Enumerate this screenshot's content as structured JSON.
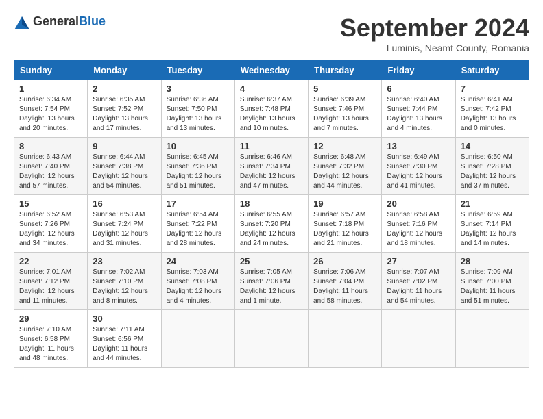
{
  "header": {
    "logo_general": "General",
    "logo_blue": "Blue",
    "month": "September 2024",
    "location": "Luminis, Neamt County, Romania"
  },
  "weekdays": [
    "Sunday",
    "Monday",
    "Tuesday",
    "Wednesday",
    "Thursday",
    "Friday",
    "Saturday"
  ],
  "weeks": [
    [
      {
        "day": "1",
        "sunrise": "6:34 AM",
        "sunset": "7:54 PM",
        "daylight": "13 hours and 20 minutes."
      },
      {
        "day": "2",
        "sunrise": "6:35 AM",
        "sunset": "7:52 PM",
        "daylight": "13 hours and 17 minutes."
      },
      {
        "day": "3",
        "sunrise": "6:36 AM",
        "sunset": "7:50 PM",
        "daylight": "13 hours and 13 minutes."
      },
      {
        "day": "4",
        "sunrise": "6:37 AM",
        "sunset": "7:48 PM",
        "daylight": "13 hours and 10 minutes."
      },
      {
        "day": "5",
        "sunrise": "6:39 AM",
        "sunset": "7:46 PM",
        "daylight": "13 hours and 7 minutes."
      },
      {
        "day": "6",
        "sunrise": "6:40 AM",
        "sunset": "7:44 PM",
        "daylight": "13 hours and 4 minutes."
      },
      {
        "day": "7",
        "sunrise": "6:41 AM",
        "sunset": "7:42 PM",
        "daylight": "13 hours and 0 minutes."
      }
    ],
    [
      {
        "day": "8",
        "sunrise": "6:43 AM",
        "sunset": "7:40 PM",
        "daylight": "12 hours and 57 minutes."
      },
      {
        "day": "9",
        "sunrise": "6:44 AM",
        "sunset": "7:38 PM",
        "daylight": "12 hours and 54 minutes."
      },
      {
        "day": "10",
        "sunrise": "6:45 AM",
        "sunset": "7:36 PM",
        "daylight": "12 hours and 51 minutes."
      },
      {
        "day": "11",
        "sunrise": "6:46 AM",
        "sunset": "7:34 PM",
        "daylight": "12 hours and 47 minutes."
      },
      {
        "day": "12",
        "sunrise": "6:48 AM",
        "sunset": "7:32 PM",
        "daylight": "12 hours and 44 minutes."
      },
      {
        "day": "13",
        "sunrise": "6:49 AM",
        "sunset": "7:30 PM",
        "daylight": "12 hours and 41 minutes."
      },
      {
        "day": "14",
        "sunrise": "6:50 AM",
        "sunset": "7:28 PM",
        "daylight": "12 hours and 37 minutes."
      }
    ],
    [
      {
        "day": "15",
        "sunrise": "6:52 AM",
        "sunset": "7:26 PM",
        "daylight": "12 hours and 34 minutes."
      },
      {
        "day": "16",
        "sunrise": "6:53 AM",
        "sunset": "7:24 PM",
        "daylight": "12 hours and 31 minutes."
      },
      {
        "day": "17",
        "sunrise": "6:54 AM",
        "sunset": "7:22 PM",
        "daylight": "12 hours and 28 minutes."
      },
      {
        "day": "18",
        "sunrise": "6:55 AM",
        "sunset": "7:20 PM",
        "daylight": "12 hours and 24 minutes."
      },
      {
        "day": "19",
        "sunrise": "6:57 AM",
        "sunset": "7:18 PM",
        "daylight": "12 hours and 21 minutes."
      },
      {
        "day": "20",
        "sunrise": "6:58 AM",
        "sunset": "7:16 PM",
        "daylight": "12 hours and 18 minutes."
      },
      {
        "day": "21",
        "sunrise": "6:59 AM",
        "sunset": "7:14 PM",
        "daylight": "12 hours and 14 minutes."
      }
    ],
    [
      {
        "day": "22",
        "sunrise": "7:01 AM",
        "sunset": "7:12 PM",
        "daylight": "12 hours and 11 minutes."
      },
      {
        "day": "23",
        "sunrise": "7:02 AM",
        "sunset": "7:10 PM",
        "daylight": "12 hours and 8 minutes."
      },
      {
        "day": "24",
        "sunrise": "7:03 AM",
        "sunset": "7:08 PM",
        "daylight": "12 hours and 4 minutes."
      },
      {
        "day": "25",
        "sunrise": "7:05 AM",
        "sunset": "7:06 PM",
        "daylight": "12 hours and 1 minute."
      },
      {
        "day": "26",
        "sunrise": "7:06 AM",
        "sunset": "7:04 PM",
        "daylight": "11 hours and 58 minutes."
      },
      {
        "day": "27",
        "sunrise": "7:07 AM",
        "sunset": "7:02 PM",
        "daylight": "11 hours and 54 minutes."
      },
      {
        "day": "28",
        "sunrise": "7:09 AM",
        "sunset": "7:00 PM",
        "daylight": "11 hours and 51 minutes."
      }
    ],
    [
      {
        "day": "29",
        "sunrise": "7:10 AM",
        "sunset": "6:58 PM",
        "daylight": "11 hours and 48 minutes."
      },
      {
        "day": "30",
        "sunrise": "7:11 AM",
        "sunset": "6:56 PM",
        "daylight": "11 hours and 44 minutes."
      },
      null,
      null,
      null,
      null,
      null
    ]
  ]
}
